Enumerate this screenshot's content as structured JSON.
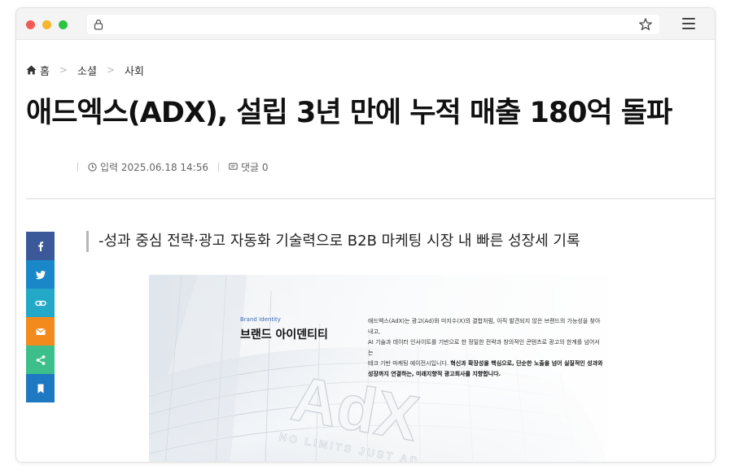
{
  "browser": {
    "url": ""
  },
  "breadcrumb": {
    "items": [
      "홈",
      "소셜",
      "사회"
    ]
  },
  "article": {
    "headline": "애드엑스(ADX), 설립 3년 만에 누적 매출 180억 돌파",
    "published": "입력 2025.06.18 14:56",
    "comments": "댓글 0",
    "subheadline": "-성과 중심 전략·광고 자동화 기술력으로 B2B 마케팅 시장 내 빠른 성장세 기록"
  },
  "share": {
    "buttons": [
      {
        "name": "facebook",
        "color": "#3b5998"
      },
      {
        "name": "twitter",
        "color": "#1a87c9"
      },
      {
        "name": "link",
        "color": "#23a9c7"
      },
      {
        "name": "email",
        "color": "#f28a1e"
      },
      {
        "name": "share",
        "color": "#3dbf8b"
      },
      {
        "name": "bookmark",
        "color": "#1e78c2"
      }
    ]
  },
  "figure": {
    "tag": "Brand Identity",
    "title": "브랜드 아이덴티티",
    "body_1": "애드엑스(AdX)는 광고(Ad)와 미지수(X)의 결합처럼, 아직 발견되지 않은 브랜드의 가능성을 찾아내고,",
    "body_2": "AI 기술과 데이터 인사이트를 기반으로 한 정밀한 전략과 창의적인 콘텐츠로 광고의 한계를 넘어서는",
    "body_3a": "테크 기반 마케팅 에이전시입니다. ",
    "body_3b": "혁신과 확장성을 핵심으로, 단순한 노출을 넘어 실질적인 성과와",
    "body_4": "성장까지 연결하는, 미래지향적 광고회사를 지향합니다.",
    "logo_text": "AdX",
    "slogan": "NO LIMITS JUST AD"
  }
}
